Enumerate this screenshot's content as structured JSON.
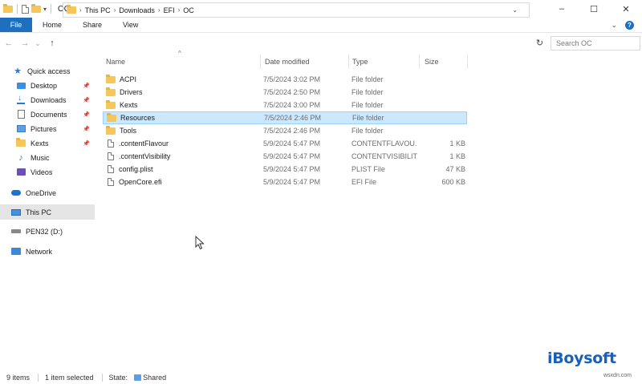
{
  "window": {
    "title": "OC",
    "controls": [
      "–",
      "☐",
      "✕"
    ]
  },
  "ribbon": {
    "tabs": [
      "File",
      "Home",
      "Share",
      "View"
    ],
    "chevron": "⌄"
  },
  "nav": {
    "back": "←",
    "forward": "→",
    "recent": "⌄",
    "up": "↑"
  },
  "address": {
    "crumbs": [
      "This PC",
      "Downloads",
      "EFI",
      "OC"
    ],
    "separator": "›"
  },
  "search": {
    "placeholder": "Search OC"
  },
  "sidebar": {
    "items": [
      {
        "label": "Quick access",
        "icon": "star-icon"
      },
      {
        "label": "Desktop",
        "icon": "desktop-icon",
        "pinned": true
      },
      {
        "label": "Downloads",
        "icon": "downloads-icon",
        "pinned": true
      },
      {
        "label": "Documents",
        "icon": "documents-icon",
        "pinned": true
      },
      {
        "label": "Pictures",
        "icon": "pictures-icon",
        "pinned": true
      },
      {
        "label": "Kexts",
        "icon": "folder-icon",
        "pinned": true
      },
      {
        "label": "Music",
        "icon": "music-icon"
      },
      {
        "label": "Videos",
        "icon": "videos-icon"
      },
      {
        "label": "OneDrive",
        "icon": "onedrive-icon"
      },
      {
        "label": "This PC",
        "icon": "this-pc-icon",
        "selected": true
      },
      {
        "label": "PEN32 (D:)",
        "icon": "drive-icon"
      },
      {
        "label": "Network",
        "icon": "network-icon"
      }
    ]
  },
  "filelist": {
    "columns": {
      "name": "Name",
      "date": "Date modified",
      "type": "Type",
      "size": "Size"
    },
    "sort_caret": "^",
    "rows": [
      {
        "name": "ACPI",
        "date": "7/5/2024 3:02 PM",
        "type": "File folder",
        "size": "",
        "kind": "folder"
      },
      {
        "name": "Drivers",
        "date": "7/5/2024 2:50 PM",
        "type": "File folder",
        "size": "",
        "kind": "folder"
      },
      {
        "name": "Kexts",
        "date": "7/5/2024 3:00 PM",
        "type": "File folder",
        "size": "",
        "kind": "folder"
      },
      {
        "name": "Resources",
        "date": "7/5/2024 2:46 PM",
        "type": "File folder",
        "size": "",
        "kind": "folder",
        "selected": true
      },
      {
        "name": "Tools",
        "date": "7/5/2024 2:46 PM",
        "type": "File folder",
        "size": "",
        "kind": "folder"
      },
      {
        "name": ".contentFlavour",
        "date": "5/9/2024 5:47 PM",
        "type": "CONTENTFLAVOU...",
        "size": "1 KB",
        "kind": "file"
      },
      {
        "name": ".contentVisibility",
        "date": "5/9/2024 5:47 PM",
        "type": "CONTENTVISIBILIT...",
        "size": "1 KB",
        "kind": "file"
      },
      {
        "name": "config.plist",
        "date": "5/9/2024 5:47 PM",
        "type": "PLIST File",
        "size": "47 KB",
        "kind": "file"
      },
      {
        "name": "OpenCore.efi",
        "date": "5/9/2024 5:47 PM",
        "type": "EFI File",
        "size": "600 KB",
        "kind": "file"
      }
    ]
  },
  "status": {
    "items_count": "9 items",
    "selected": "1 item selected",
    "state_label": "State:",
    "state_value": "Shared"
  },
  "watermark": {
    "brand": "iBoysoft",
    "site": "wsxdn.com"
  },
  "colors": {
    "accent": "#1f6fbf",
    "selection_bg": "#cce8ff",
    "selection_border": "#99d1ff",
    "folder": "#f5c75a"
  }
}
